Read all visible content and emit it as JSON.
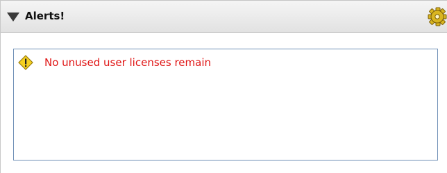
{
  "panel": {
    "title": "Alerts!",
    "collapse_icon": "triangle-down-icon",
    "settings_icon": "gear-icon"
  },
  "alerts": [
    {
      "icon": "warning-icon",
      "message": "No unused user licenses remain",
      "color": "#e01414"
    }
  ],
  "colors": {
    "alert_text": "#e01414",
    "alert_box_border": "#6f8fb6",
    "header_background": "#e9e9e9"
  }
}
